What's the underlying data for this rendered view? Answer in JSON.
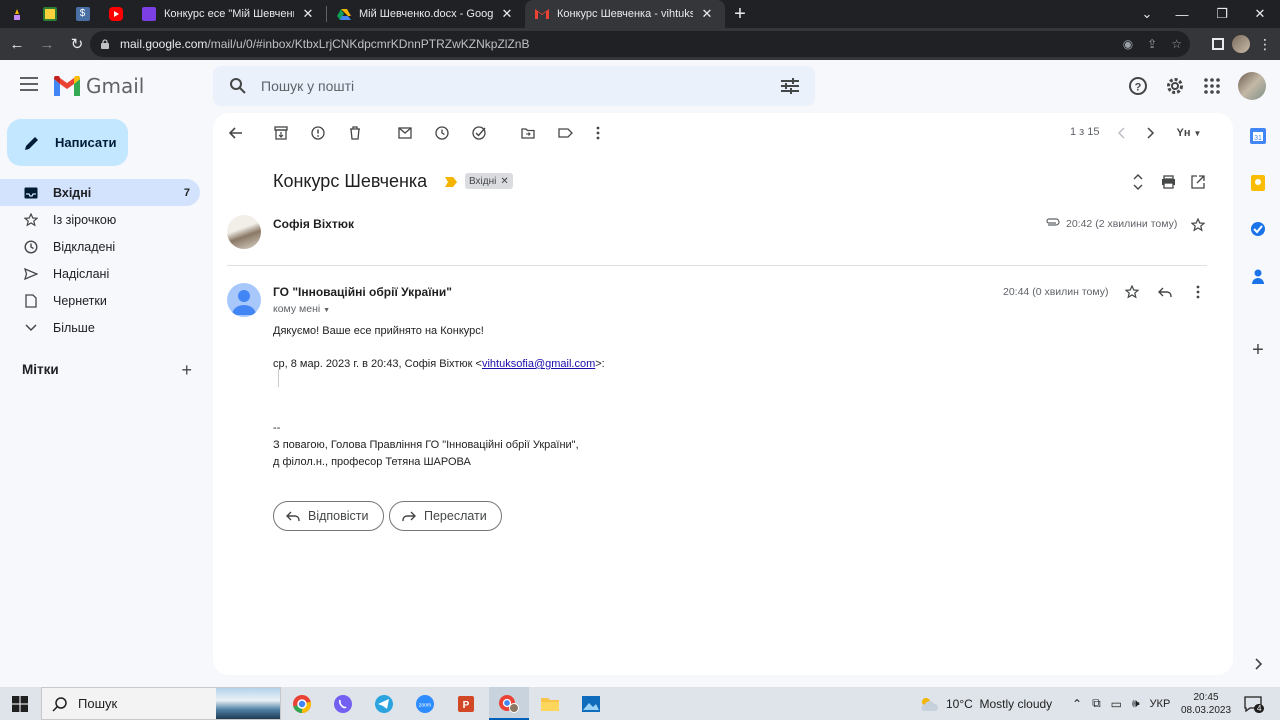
{
  "browser": {
    "tabs": [
      {
        "title": "Конкурс есе \"Мій Шевченко\"",
        "icon_color": "#7b3fe4"
      },
      {
        "title": "Мій Шевченко.docx - Google Ди",
        "icon_color": "#1fa463"
      },
      {
        "title": "Конкурс Шевченка - vihtuksofia",
        "icon_color": "#ea4335"
      }
    ],
    "url_host": "mail.google.com",
    "url_path": "/mail/u/0/#inbox/KtbxLrjCNKdpcmrKDnnPTRZwKZNkpZlZnB"
  },
  "gmail": {
    "logo_text": "Gmail",
    "search_placeholder": "Пошук у пошті",
    "compose_label": "Написати",
    "nav": [
      {
        "label": "Вхідні",
        "count": "7",
        "icon": "inbox-icon"
      },
      {
        "label": "Із зірочкою",
        "count": "",
        "icon": "star-icon"
      },
      {
        "label": "Відкладені",
        "count": "",
        "icon": "clock-icon"
      },
      {
        "label": "Надіслані",
        "count": "",
        "icon": "send-icon"
      },
      {
        "label": "Чернетки",
        "count": "",
        "icon": "draft-icon"
      },
      {
        "label": "Більше",
        "count": "",
        "icon": "chevron-down-icon"
      }
    ],
    "labels_heading": "Мітки",
    "pager": "1 з 15",
    "lang_toggle": "Yн"
  },
  "thread": {
    "subject": "Конкурс Шевченка",
    "chip": "Вхідні",
    "collapsed_message": {
      "sender": "Софія Віхтюк",
      "time": "20:42 (2 хвилини тому)"
    },
    "message": {
      "sender": "ГО \"Інноваційні обрії України\"",
      "to": "кому мені",
      "time": "20:44 (0 хвилин тому)",
      "line1": "Дякуємо! Ваше есе прийнято на Конкурс!",
      "quote_prefix": "ср, 8 мар. 2023 г. в 20:43, Софія Віхтюк <",
      "quote_email": "vihtuksofia@gmail.com",
      "quote_suffix": ">:",
      "sig_dash": "--",
      "sig_line1": "З повагою, Голова Правління ГО \"Інноваційні обрії України\",",
      "sig_line2": "д філол.н., професор Тетяна ШАРОВА"
    },
    "reply_label": "Відповісти",
    "forward_label": "Переслати"
  },
  "taskbar": {
    "search_text": "Пошук",
    "weather": "10°C  Mostly cloudy",
    "lang": "УКР",
    "clock_time": "20:45",
    "clock_date": "08.03.2023",
    "notif_count": "4"
  }
}
